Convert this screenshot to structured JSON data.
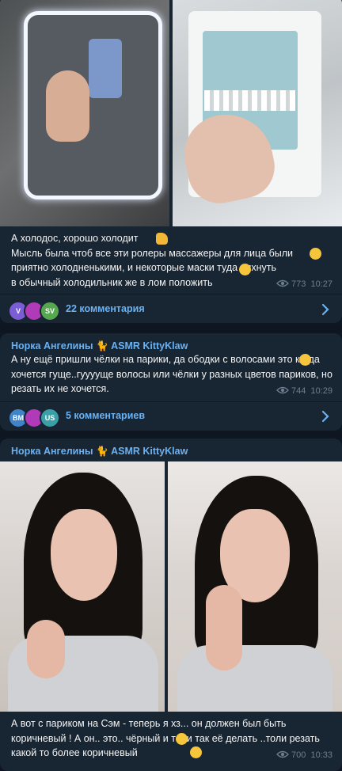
{
  "post1": {
    "text": "А холодос,  хорошо холодит \nМысль была чтоб все эти ролеры массажеры для лица были приятно холодненькими,  и некоторые маски туда пихнуть \nв  обычный холодильник же в лом положить ",
    "views": "773",
    "time": "10:27",
    "avatars": [
      "V",
      "",
      "SV"
    ],
    "comments_label": "22 комментария"
  },
  "post2": {
    "author": "Норка Ангелины 🐈 ASMR KittyKlaw",
    "text": "А ну ещё пришли чёлки на парики, да ободки с волосами  это когда хочется гуще..гууууще волосы или чёлки у разных цветов париков, но резать их не хочется.",
    "views": "744",
    "time": "10:29",
    "avatars": [
      "BM",
      "",
      "US"
    ],
    "comments_label": "5 комментариев"
  },
  "post3": {
    "author": "Норка Ангелины 🐈 ASMR KittyKlaw",
    "text": "А вот с париком на Сэм - теперь я хз... он должен был быть коричневый ! А он.. это.. чёрный  и толи так её делать ..толи резать какой то более коричневый ",
    "views": "700",
    "time": "10:33"
  },
  "colors": {
    "background": "#0e1621",
    "bubble": "#182533",
    "accent": "#6ab2f2",
    "meta": "#6d7f8f"
  },
  "icons": [
    "eye-icon",
    "chevron-right-icon",
    "thumbs-up-emoji",
    "thinking-emoji",
    "laughing-emoji",
    "grinning-emoji"
  ]
}
